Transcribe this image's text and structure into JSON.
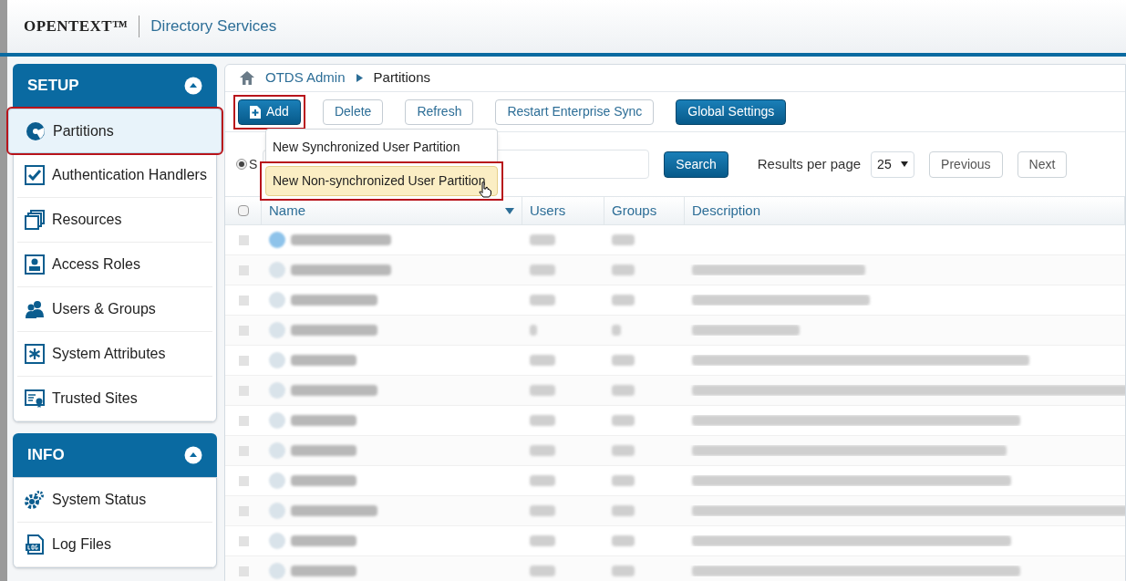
{
  "header": {
    "logo": "OPENTEXT™",
    "product": "Directory Services"
  },
  "sidebar": {
    "sections": [
      {
        "title": "SETUP",
        "expanded": true,
        "items": [
          {
            "label": "Partitions",
            "selected": true,
            "highlighted": true
          },
          {
            "label": "Authentication Handlers",
            "selected": false,
            "highlighted": false
          },
          {
            "label": "Resources",
            "selected": false,
            "highlighted": false
          },
          {
            "label": "Access Roles",
            "selected": false,
            "highlighted": false
          },
          {
            "label": "Users & Groups",
            "selected": false,
            "highlighted": false
          },
          {
            "label": "System Attributes",
            "selected": false,
            "highlighted": false
          },
          {
            "label": "Trusted Sites",
            "selected": false,
            "highlighted": false
          }
        ]
      },
      {
        "title": "INFO",
        "expanded": true,
        "items": [
          {
            "label": "System Status",
            "selected": false,
            "highlighted": false
          },
          {
            "label": "Log Files",
            "selected": false,
            "highlighted": false
          }
        ]
      }
    ]
  },
  "breadcrumb": [
    {
      "label": "OTDS Admin",
      "link": true
    },
    {
      "label": "Partitions",
      "link": false
    }
  ],
  "toolbar": [
    {
      "label": "Add",
      "kind": "primary",
      "highlighted": true
    },
    {
      "label": "Delete",
      "kind": "plain",
      "highlighted": false
    },
    {
      "label": "Refresh",
      "kind": "plain",
      "highlighted": false
    },
    {
      "label": "Restart Enterprise Sync",
      "kind": "plain",
      "highlighted": false
    },
    {
      "label": "Global Settings",
      "kind": "primary",
      "highlighted": false
    }
  ],
  "add_menu": [
    {
      "label": "New Synchronized User Partition",
      "hovered": false
    },
    {
      "label": "New Non-synchronized User Partition",
      "hovered": true
    }
  ],
  "search": {
    "radio_label": "S",
    "radio_checked": true,
    "button": "Search"
  },
  "paging": {
    "label": "Results per page",
    "per_page": "25",
    "previous": "Previous",
    "next": "Next"
  },
  "table": {
    "select_all_checked": false,
    "columns": [
      {
        "label": "Name",
        "sorted": true
      },
      {
        "label": "Users",
        "sorted": false
      },
      {
        "label": "Groups",
        "sorted": false
      },
      {
        "label": "Description",
        "sorted": false
      }
    ],
    "rows": [
      {
        "kind": "redacted",
        "description": false
      },
      {
        "kind": "redacted",
        "description": true
      },
      {
        "kind": "redacted",
        "description": true
      },
      {
        "kind": "redacted",
        "description": true
      },
      {
        "kind": "redacted",
        "description": true
      },
      {
        "kind": "redacted",
        "description": true
      },
      {
        "kind": "redacted",
        "description": true
      },
      {
        "kind": "redacted",
        "description": true
      },
      {
        "kind": "redacted",
        "description": true
      },
      {
        "kind": "redacted",
        "description": true
      },
      {
        "kind": "redacted",
        "description": true
      },
      {
        "kind": "redacted",
        "description": true
      }
    ]
  }
}
